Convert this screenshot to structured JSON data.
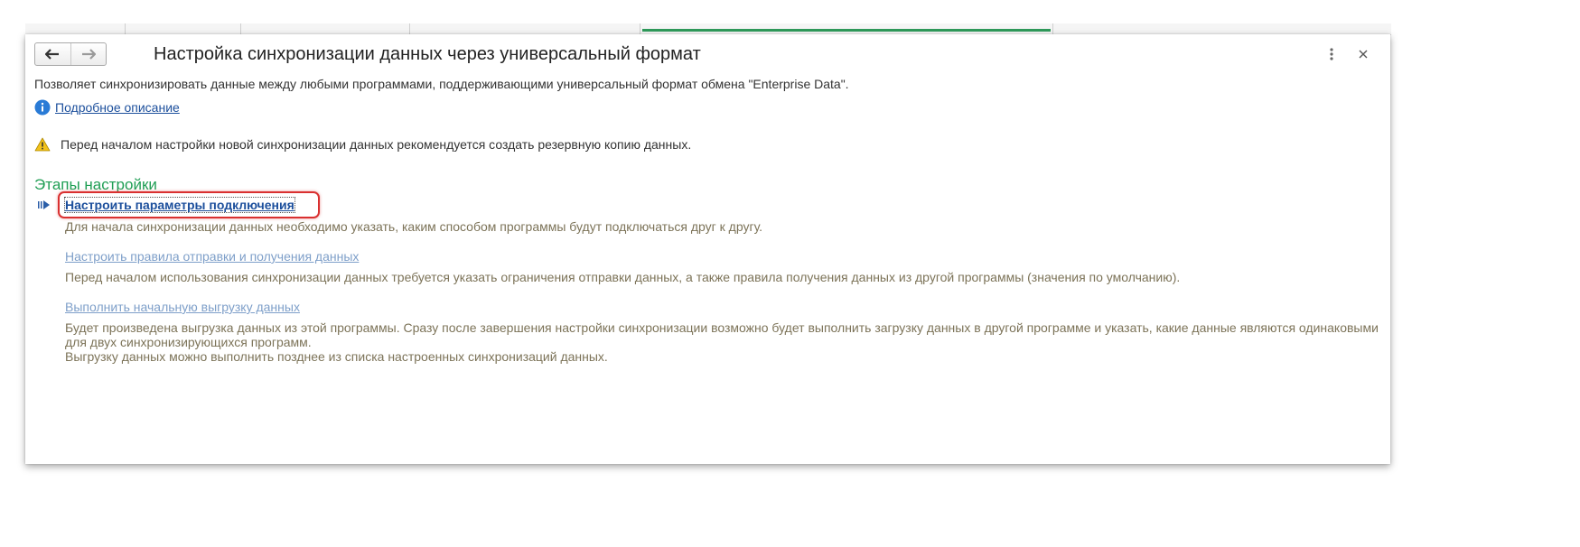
{
  "window": {
    "title": "Настройка синхронизации данных через универсальный формат",
    "description": "Позволяет синхронизировать данные между любыми программами, поддерживающими универсальный формат обмена \"Enterprise Data\".",
    "details_link": "Подробное описание",
    "warning": "Перед началом настройки новой синхронизации данных рекомендуется создать резервную копию данных."
  },
  "stages": {
    "title": "Этапы настройки",
    "steps": [
      {
        "label": "Настроить параметры подключения",
        "description": "Для начала синхронизации данных необходимо указать, каким способом программы будут подключаться друг к другу."
      },
      {
        "label": "Настроить правила отправки и получения данных",
        "description": "Перед началом использования синхронизации данных требуется указать ограничения отправки данных, а также правила получения данных из другой программы (значения по умолчанию)."
      },
      {
        "label": "Выполнить начальную выгрузку данных",
        "description": "Будет произведена выгрузка данных из этой программы. Сразу после завершения настройки синхронизации возможно будет выполнить загрузку данных в другой программе и указать, какие данные являются одинаковыми для двух синхронизирующихся программ.",
        "description_extra": "Выгрузку данных можно выполнить позднее из списка настроенных синхронизаций данных."
      }
    ]
  },
  "colors": {
    "accent_green": "#1f9e54",
    "link_blue": "#1c4f9c",
    "muted_link": "#7e9fc9",
    "muted_text": "#7c7358",
    "highlight_red": "#d93030"
  },
  "icons": {
    "back": "arrow-left-icon",
    "forward": "arrow-right-icon",
    "more": "more-vertical-icon",
    "close": "close-icon",
    "info": "info-icon",
    "warning": "warning-icon",
    "current_step": "current-step-arrow-icon"
  }
}
